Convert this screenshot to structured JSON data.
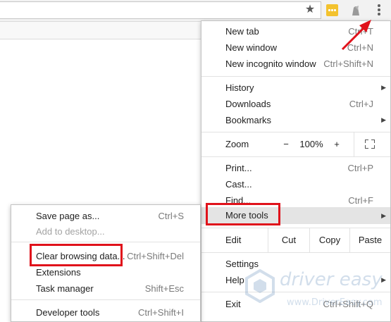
{
  "main_menu": {
    "new_tab": {
      "label": "New tab",
      "shortcut": "Ctrl+T"
    },
    "new_window": {
      "label": "New window",
      "shortcut": "Ctrl+N"
    },
    "new_incognito": {
      "label": "New incognito window",
      "shortcut": "Ctrl+Shift+N"
    },
    "history": {
      "label": "History"
    },
    "downloads": {
      "label": "Downloads",
      "shortcut": "Ctrl+J"
    },
    "bookmarks": {
      "label": "Bookmarks"
    },
    "zoom": {
      "label": "Zoom",
      "minus": "−",
      "value": "100%",
      "plus": "+"
    },
    "print": {
      "label": "Print...",
      "shortcut": "Ctrl+P"
    },
    "cast": {
      "label": "Cast..."
    },
    "find": {
      "label": "Find...",
      "shortcut": "Ctrl+F"
    },
    "more_tools": {
      "label": "More tools"
    },
    "edit": {
      "label": "Edit",
      "cut": "Cut",
      "copy": "Copy",
      "paste": "Paste"
    },
    "settings": {
      "label": "Settings"
    },
    "help": {
      "label": "Help"
    },
    "exit": {
      "label": "Exit",
      "shortcut": "Ctrl+Shift+Q"
    }
  },
  "more_tools_menu": {
    "save_page": {
      "label": "Save page as...",
      "shortcut": "Ctrl+S"
    },
    "add_to_desktop": {
      "label": "Add to desktop..."
    },
    "clear_browsing": {
      "label": "Clear browsing data...",
      "shortcut": "Ctrl+Shift+Del"
    },
    "extensions": {
      "label": "Extensions"
    },
    "task_manager": {
      "label": "Task manager",
      "shortcut": "Shift+Esc"
    },
    "developer_tools": {
      "label": "Developer tools",
      "shortcut": "Ctrl+Shift+I"
    }
  },
  "watermark": {
    "brand": "driver easy",
    "url": "www.DriverEasy.com"
  },
  "icons": {
    "star": "★",
    "fullscreen": "fullscreen-icon",
    "submenu_arrow": "▶"
  },
  "colors": {
    "highlight_red": "#e0121b",
    "menu_hover": "#e4e4e4"
  }
}
